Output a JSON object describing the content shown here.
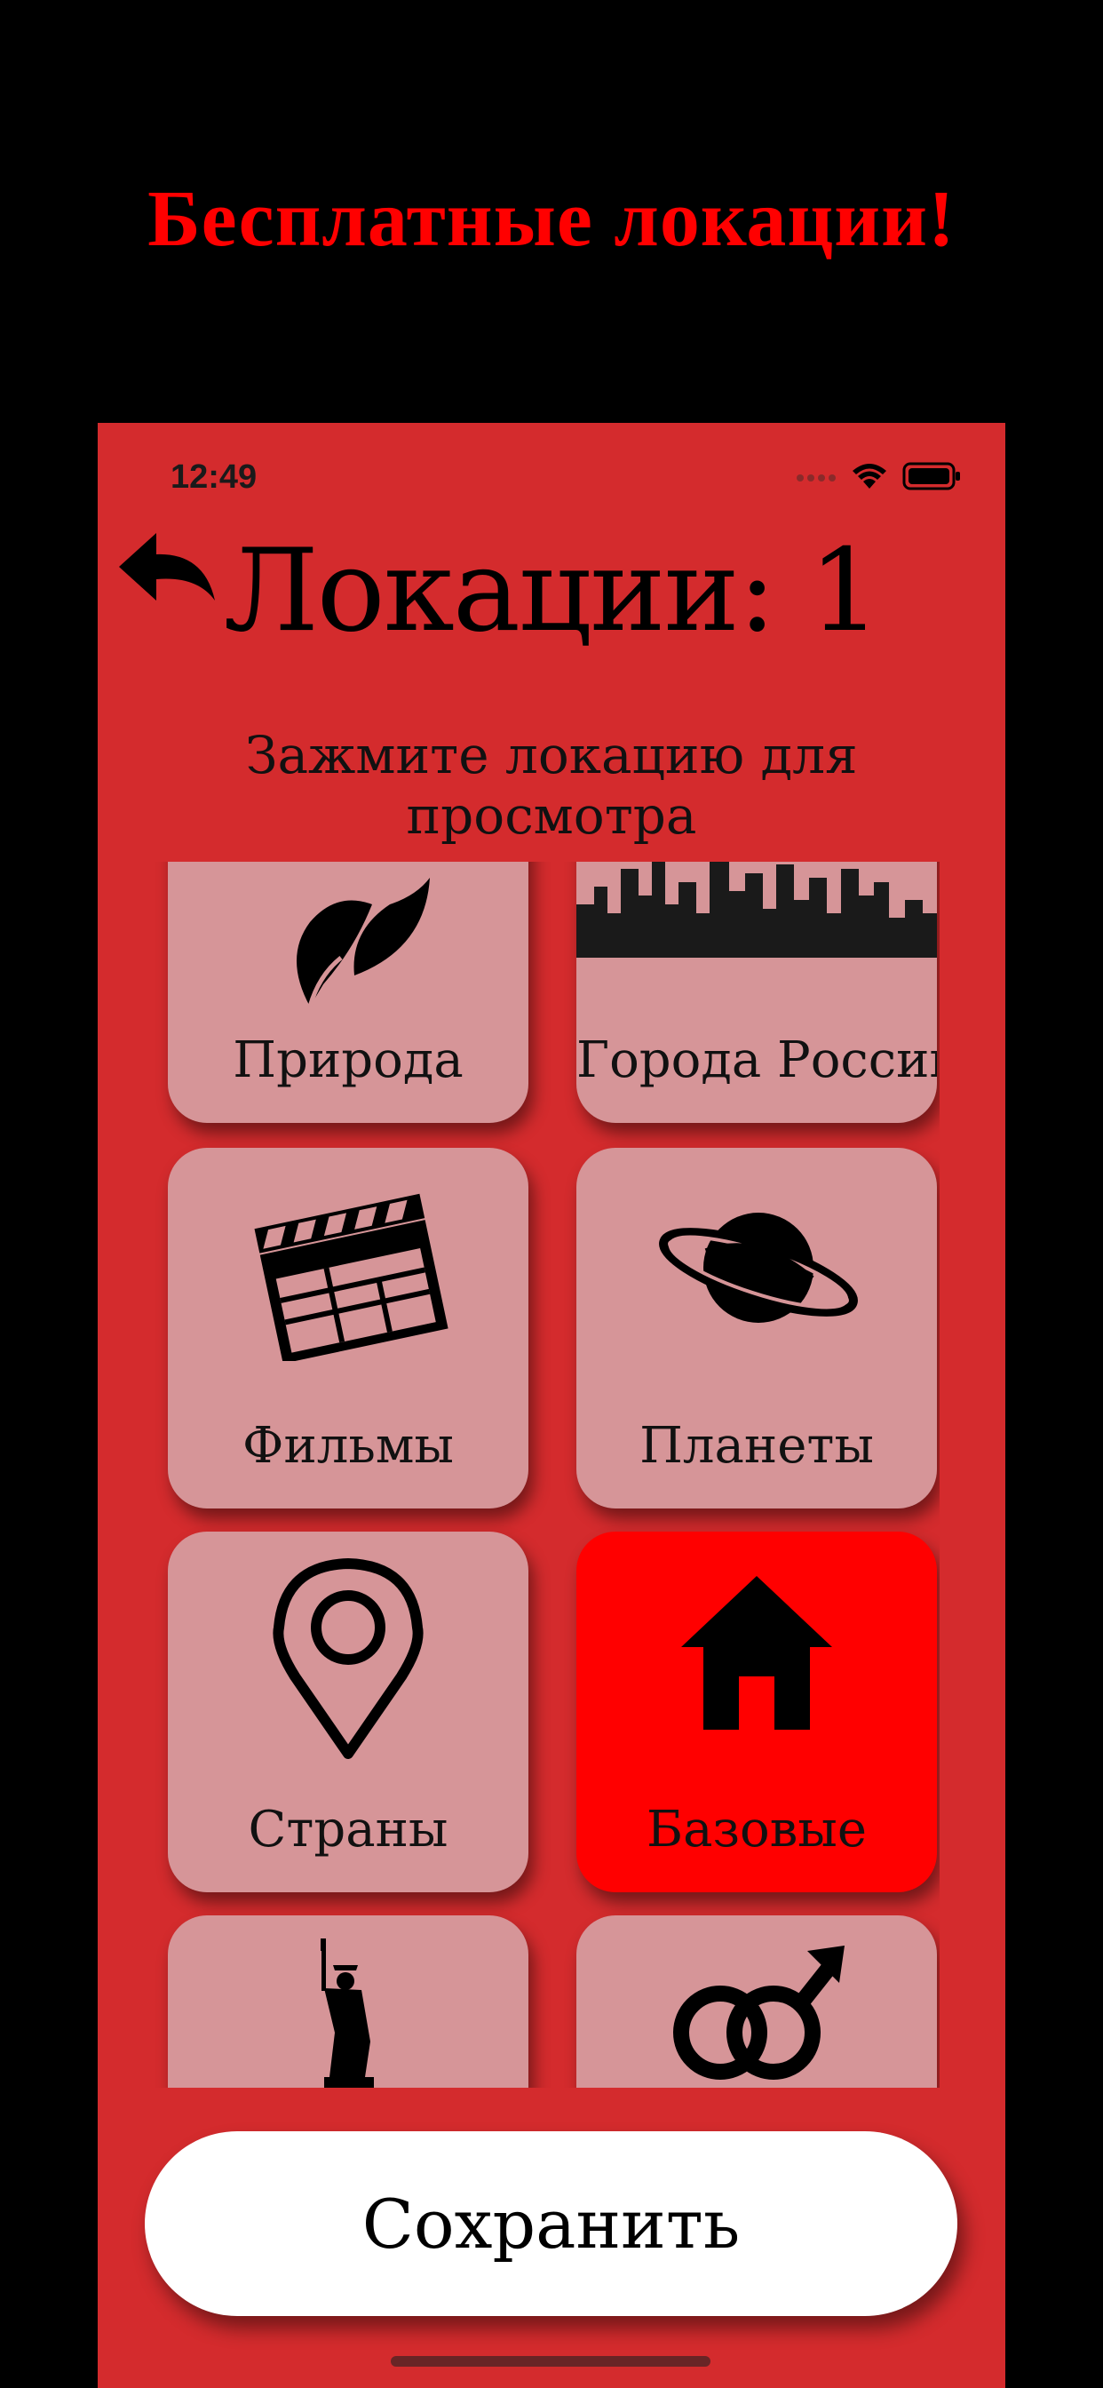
{
  "promo": {
    "headline": "Бесплатные локации!"
  },
  "status_bar": {
    "time": "12:49"
  },
  "header": {
    "title": "Локации: 1",
    "subtitle": "Зажмите локацию для просмотра"
  },
  "tiles": [
    {
      "label": "Природа",
      "icon": "leaves-icon",
      "selected": false
    },
    {
      "label": "Города России",
      "icon": "city-skyline-icon",
      "selected": false
    },
    {
      "label": "Фильмы",
      "icon": "clapperboard-icon",
      "selected": false
    },
    {
      "label": "Планеты",
      "icon": "planet-icon",
      "selected": false
    },
    {
      "label": "Страны",
      "icon": "map-pin-icon",
      "selected": false
    },
    {
      "label": "Базовые",
      "icon": "house-icon",
      "selected": true
    },
    {
      "label": "",
      "icon": "statue-of-liberty-icon",
      "selected": false
    },
    {
      "label": "",
      "icon": "gender-symbols-icon",
      "selected": false
    }
  ],
  "footer": {
    "save_label": "Сохранить"
  },
  "colors": {
    "background": "#000000",
    "panel": "#d42b2d",
    "tile": "#d69598",
    "tile_selected": "#ff0000",
    "promo_text": "#ff0000"
  }
}
